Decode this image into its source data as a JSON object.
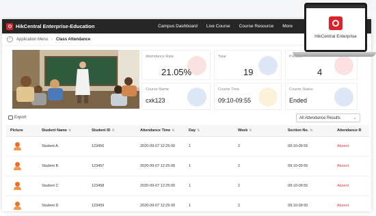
{
  "app": {
    "title": "HikCentral Enterprise-Education"
  },
  "nav": [
    {
      "label": "Campus Dashboard"
    },
    {
      "label": "Live Course"
    },
    {
      "label": "Course Resource"
    },
    {
      "label": "More"
    }
  ],
  "breadcrumb": {
    "parent": "Application Menu",
    "current": "Class Attendance"
  },
  "stats": {
    "attendance_rate": {
      "label": "Attendance Rate",
      "value": "21.05%"
    },
    "total": {
      "label": "Total",
      "value": "19"
    },
    "present": {
      "label": "Present",
      "value": "4"
    },
    "course_name": {
      "label": "Course Name",
      "value": "cxk123"
    },
    "course_time": {
      "label": "Course Time",
      "value": "09:10-09:55"
    },
    "course_status": {
      "label": "Course Status",
      "value": "Ended"
    }
  },
  "toolbar": {
    "export_label": "Export",
    "filter_value": "All Attendance Results"
  },
  "table": {
    "columns": [
      "Picture",
      "Student Name",
      "Student ID",
      "Attendance Time",
      "Day",
      "Week",
      "Section No.",
      "Attendance R"
    ],
    "rows": [
      {
        "name": "Student A",
        "id": "123456",
        "time": "2020-09-07 12:25:00",
        "day": "1",
        "week": "2",
        "section": "09:10-09:55",
        "result": "Absent"
      },
      {
        "name": "Student B",
        "id": "123457",
        "time": "2020-09-07 12:25:00",
        "day": "1",
        "week": "2",
        "section": "09:10-09:55",
        "result": "Absent"
      },
      {
        "name": "Student C",
        "id": "123458",
        "time": "2020-09-07 12:25:00",
        "day": "1",
        "week": "2",
        "section": "09:10-09:55",
        "result": "Absent"
      },
      {
        "name": "Student D",
        "id": "123459",
        "time": "2020-09-07 12:25:00",
        "day": "1",
        "week": "2",
        "section": "09:10-09:55",
        "result": "Absent"
      }
    ]
  },
  "laptop": {
    "brand": "HikCentral Enterprise"
  },
  "colors": {
    "brand_red": "#d8242a",
    "absent_red": "#e0393e",
    "topbar": "#262626"
  },
  "icons": [
    "back-icon",
    "export-icon",
    "chevron-down-icon",
    "sort-icon",
    "student-avatar-icon",
    "hikcentral-logo-icon"
  ]
}
